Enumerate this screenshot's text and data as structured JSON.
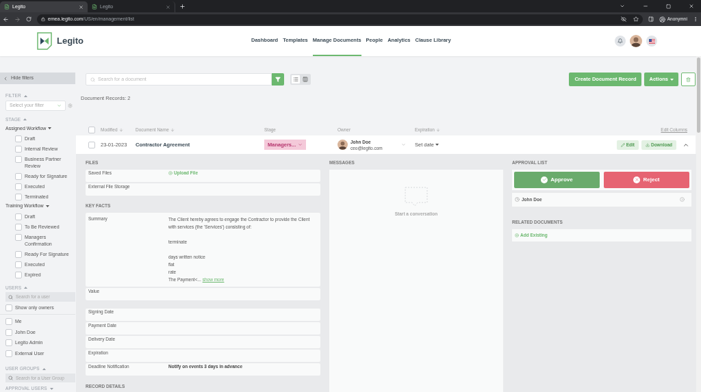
{
  "browser": {
    "tabs": [
      {
        "title": "Legito",
        "selected": true
      },
      {
        "title": "Legito",
        "selected": false
      }
    ],
    "url_host": "emea.legito.com",
    "url_path": "/US/en/management/list",
    "profile": "Anonymní"
  },
  "header": {
    "logo": "Legito",
    "nav": [
      {
        "label": "Dashboard",
        "selected": false
      },
      {
        "label": "Templates",
        "selected": false
      },
      {
        "label": "Manage Documents",
        "selected": true
      },
      {
        "label": "People",
        "selected": false
      },
      {
        "label": "Analytics",
        "selected": false
      },
      {
        "label": "Clause Library",
        "selected": false
      }
    ]
  },
  "sidebar": {
    "hide_filters": "Hide filters",
    "filter_title": "FILTER",
    "filter_placeholder": "Select your filter",
    "stage_title": "STAGE",
    "workflows": [
      {
        "name": "Assigned Workflow",
        "options": [
          {
            "label": "Draft",
            "checked": false
          },
          {
            "label": "Internal Review",
            "checked": false
          },
          {
            "label": "Business Partner Review",
            "checked": false
          },
          {
            "label": "Ready for Signature",
            "checked": false
          },
          {
            "label": "Executed",
            "checked": false
          },
          {
            "label": "Terminated",
            "checked": false
          }
        ]
      },
      {
        "name": "Training Workflow",
        "options": [
          {
            "label": "Draft",
            "checked": false
          },
          {
            "label": "To Be Reviewed",
            "checked": false
          },
          {
            "label": "Managers Confirmation",
            "checked": false
          },
          {
            "label": "Ready For Signature",
            "checked": false
          },
          {
            "label": "Executed",
            "checked": false
          },
          {
            "label": "Expired",
            "checked": false
          }
        ]
      }
    ],
    "users_title": "USERS",
    "user_search_placeholder": "Search for a user",
    "show_only_owners": {
      "label": "Show only owners",
      "checked": false
    },
    "users": [
      {
        "label": "Me",
        "checked": false
      },
      {
        "label": "John Doe",
        "checked": false
      },
      {
        "label": "Legito Admin",
        "checked": false
      },
      {
        "label": "External User",
        "checked": false
      }
    ],
    "user_groups_title": "USER GROUPS",
    "user_group_search_placeholder": "Search for a User Group",
    "approval_users_title": "APPROVAL USERS"
  },
  "toolbar": {
    "search_placeholder": "Search for a document",
    "views": [
      {
        "kind": "list",
        "selected": true
      },
      {
        "kind": "columns",
        "selected": false
      }
    ],
    "create_button": "Create Document Record",
    "actions_button": "Actions"
  },
  "records_count": "Document Records: 2",
  "columns": [
    {
      "label": "Modified",
      "sorted": true
    },
    {
      "label": "Document Name",
      "sorted": true
    },
    {
      "label": "Stage",
      "sorted": false
    },
    {
      "label": "Owner",
      "sorted": false
    },
    {
      "label": "Expiration",
      "sorted": true
    }
  ],
  "select_all": {
    "checked": false
  },
  "edit_columns": "Edit Columns",
  "document": {
    "checked": false,
    "modified": "23-01-2023",
    "name": "Contractor Agreement",
    "stage": "Managers...",
    "owner_name": "John Doe",
    "owner_email": "ceo@legito.com",
    "expiration": "Set date",
    "edit": "Edit",
    "download": "Download",
    "expanded": true
  },
  "details": {
    "files_title": "FILES",
    "files": [
      {
        "label": "Saved Files",
        "action": "Upload File"
      },
      {
        "label": "External File Storage"
      }
    ],
    "key_facts_title": "KEY FACTS",
    "summary_label": "Summary",
    "summary_lines": [
      {
        "text": "The Client hereby agrees to engage the Contractor to provide the Client with services (the 'Services') consisting of:",
        "spaced": false
      },
      {
        "text": "terminate",
        "spaced": true
      },
      {
        "text": "days written notice",
        "spaced": true
      },
      {
        "text": "flat",
        "spaced": false
      },
      {
        "text": "rate",
        "spaced": false
      },
      {
        "text": "The Payment<...",
        "spaced": false
      }
    ],
    "show_more": "show more",
    "value_label": "Value",
    "dates": [
      {
        "label": "Signing Date"
      },
      {
        "label": "Payment Date"
      },
      {
        "label": "Delivery Date"
      },
      {
        "label": "Expiration"
      },
      {
        "label": "Deadline Notification",
        "value": "Notify on events 3 days in advance"
      }
    ],
    "record_details_title": "RECORD DETAILS"
  },
  "messages": {
    "title": "MESSAGES",
    "empty_text": "Start a conversation"
  },
  "approval": {
    "title": "APPROVAL LIST",
    "approve": "Approve",
    "reject": "Reject",
    "approvers": [
      {
        "name": "John Doe"
      }
    ],
    "related_title": "RELATED DOCUMENTS",
    "add_existing": "Add Existing"
  }
}
